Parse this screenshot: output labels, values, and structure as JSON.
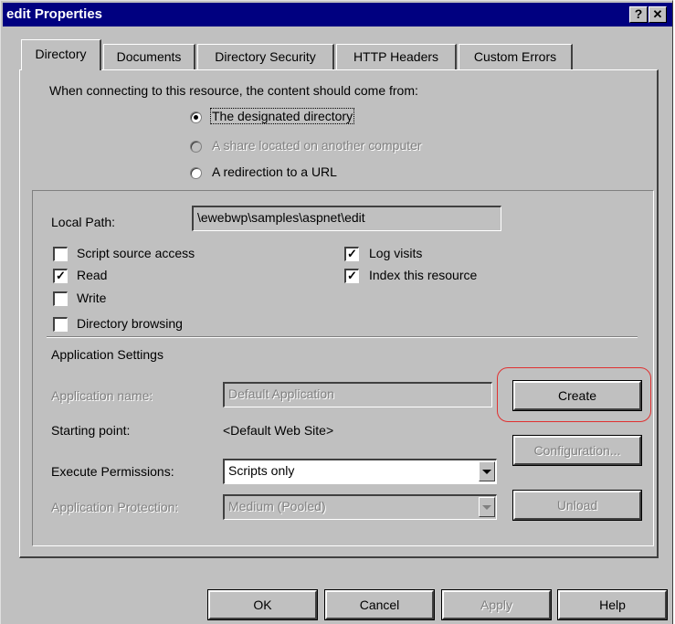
{
  "window": {
    "title": "edit Properties",
    "help_btn": "?",
    "close_btn": "✕"
  },
  "tabs": [
    "Directory",
    "Documents",
    "Directory Security",
    "HTTP Headers",
    "Custom Errors"
  ],
  "source": {
    "prompt": "When connecting to this resource, the content should come from:",
    "options": [
      {
        "label": "The designated directory",
        "selected": true,
        "enabled": true
      },
      {
        "label": "A share located on another computer",
        "selected": false,
        "enabled": false
      },
      {
        "label": "A redirection to a URL",
        "selected": false,
        "enabled": true
      }
    ]
  },
  "local_path": {
    "label": "Local Path:",
    "value": "\\ewebwp\\samples\\aspnet\\edit"
  },
  "checkboxes": {
    "script_source_access": {
      "label": "Script source access",
      "checked": false
    },
    "read": {
      "label": "Read",
      "checked": true
    },
    "write": {
      "label": "Write",
      "checked": false
    },
    "directory_browsing": {
      "label": "Directory browsing",
      "checked": false
    },
    "log_visits": {
      "label": "Log visits",
      "checked": true
    },
    "index_resource": {
      "label": "Index this resource",
      "checked": true
    }
  },
  "app_settings": {
    "heading": "Application Settings",
    "app_name_label": "Application name:",
    "app_name_value": "Default Application",
    "starting_point_label": "Starting point:",
    "starting_point_value": "<Default Web Site>",
    "exec_perm_label": "Execute Permissions:",
    "exec_perm_value": "Scripts only",
    "protection_label": "Application Protection:",
    "protection_value": "Medium (Pooled)",
    "create_btn": "Create",
    "config_btn": "Configuration...",
    "unload_btn": "Unload"
  },
  "footer": {
    "ok": "OK",
    "cancel": "Cancel",
    "apply": "Apply",
    "help": "Help"
  },
  "colors": {
    "titlebar": "#000080",
    "face": "#c0c0c0",
    "highlight_ring": "#e03030"
  }
}
